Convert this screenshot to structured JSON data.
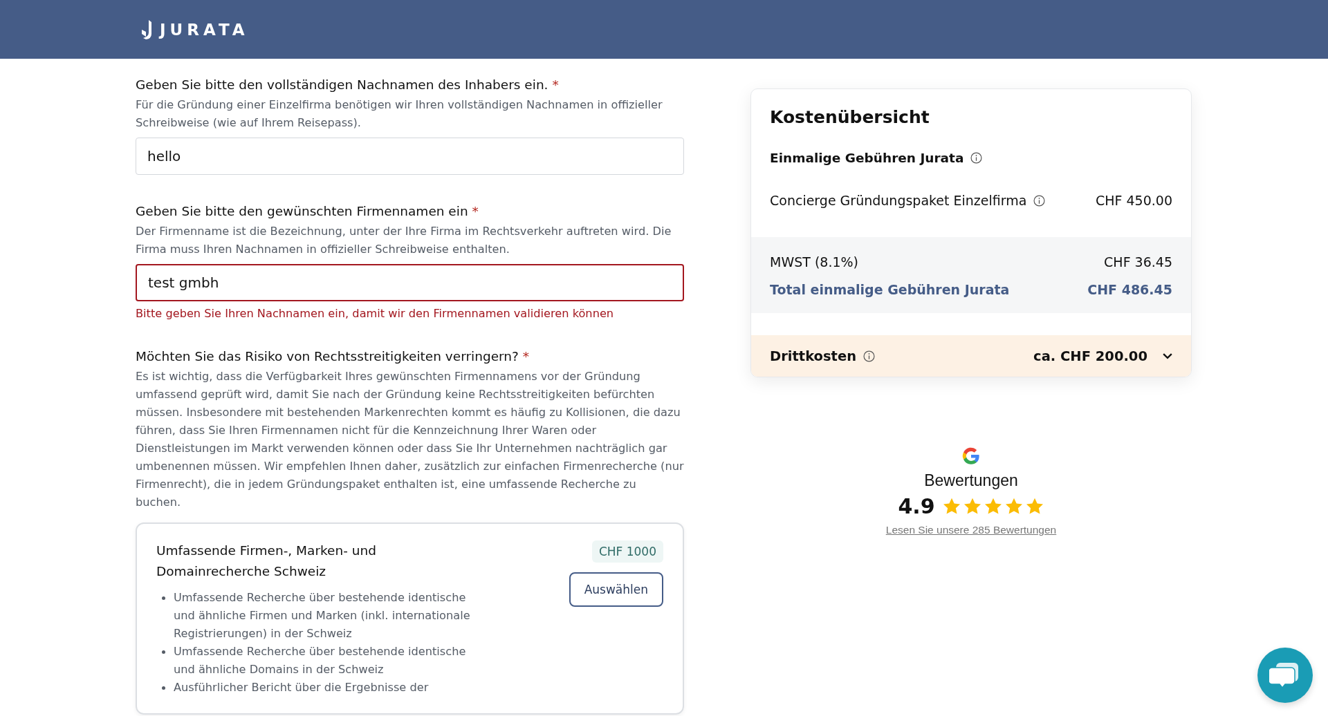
{
  "header": {
    "logo": "JURATA"
  },
  "form": {
    "fields": [
      {
        "kind": "text",
        "label": "Geben Sie bitte den vollständigen Nachnamen des Inhabers ein.",
        "required_mark": "*",
        "description": "Für die Gründung einer Einzelfirma benötigen wir Ihren vollständigen Nachnamen in offizieller Schreibweise (wie auf Ihrem Reisepass).",
        "value": "hello",
        "invalid": false
      },
      {
        "kind": "text",
        "label": "Geben Sie bitte den gewünschten Firmennamen ein",
        "required_mark": "*",
        "description": "Der Firmenname ist die Bezeichnung, unter der Ihre Firma im Rechtsverkehr auftreten wird. Die Firma muss Ihren Nachnamen in offizieller Schreibweise enthalten.",
        "value": "test gmbh",
        "invalid": true,
        "error": "Bitte geben Sie Ihren Nachnamen ein, damit wir den Firmennamen validieren können"
      },
      {
        "kind": "options",
        "label": "Möchten Sie das Risiko von Rechtsstreitigkeiten verringern?",
        "required_mark": "*",
        "description": "Es ist wichtig, dass die Verfügbarkeit Ihres gewünschten Firmennamens vor der Gründung umfassend geprüft wird, damit Sie nach der Gründung keine Rechtsstreitigkeiten befürchten müssen. Insbesondere mit bestehenden Markenrechten kommt es häufig zu Kollisionen, die dazu führen, dass Sie Ihren Firmennamen nicht für die Kennzeichnung Ihrer Waren oder Dienstleistungen im Markt verwenden können oder dass Sie Ihr Unternehmen nachträglich gar umbenennen müssen. Wir empfehlen Ihnen daher, zusätzlich zur einfachen Firmenrecherche (nur Firmenrecht), die in jedem Gründungspaket enthalten ist, eine umfassende Recherche zu buchen.",
        "options": [
          {
            "title": "Umfassende Firmen-, Marken- und Domainrecherche Schweiz",
            "price": "CHF 1000",
            "button": "Auswählen",
            "selected": false,
            "bullets": [
              "Umfassende Recherche über bestehende identische und ähnliche Firmen und Marken (inkl. internationale Registrierungen) in der Schweiz",
              "Umfassende Recherche über bestehende identische und ähnliche Domains in der Schweiz",
              "Ausführlicher Bericht über die Ergebnisse der"
            ]
          }
        ]
      }
    ]
  },
  "costs": {
    "title": "Kostenübersicht",
    "section": {
      "title": "Einmalige Gebühren Jurata",
      "info": true
    },
    "lines": [
      {
        "kind": "item",
        "label": "Concierge Gründungspaket Einzelfirma",
        "info": true,
        "amount": "CHF 450.00"
      },
      {
        "kind": "tax",
        "label": "MWST (8.1%)",
        "info": false,
        "amount": "CHF 36.45"
      },
      {
        "kind": "total",
        "label": "Total einmalige Gebühren Jurata",
        "info": false,
        "amount": "CHF 486.45"
      }
    ],
    "third_party": {
      "label": "Drittkosten",
      "info": true,
      "amount": "ca. CHF 200.00",
      "expanded": false
    }
  },
  "reviews": {
    "title": "Bewertungen",
    "score": "4.9",
    "stars": 5,
    "link": "Lesen Sie unsere 285 Bewertungen"
  }
}
